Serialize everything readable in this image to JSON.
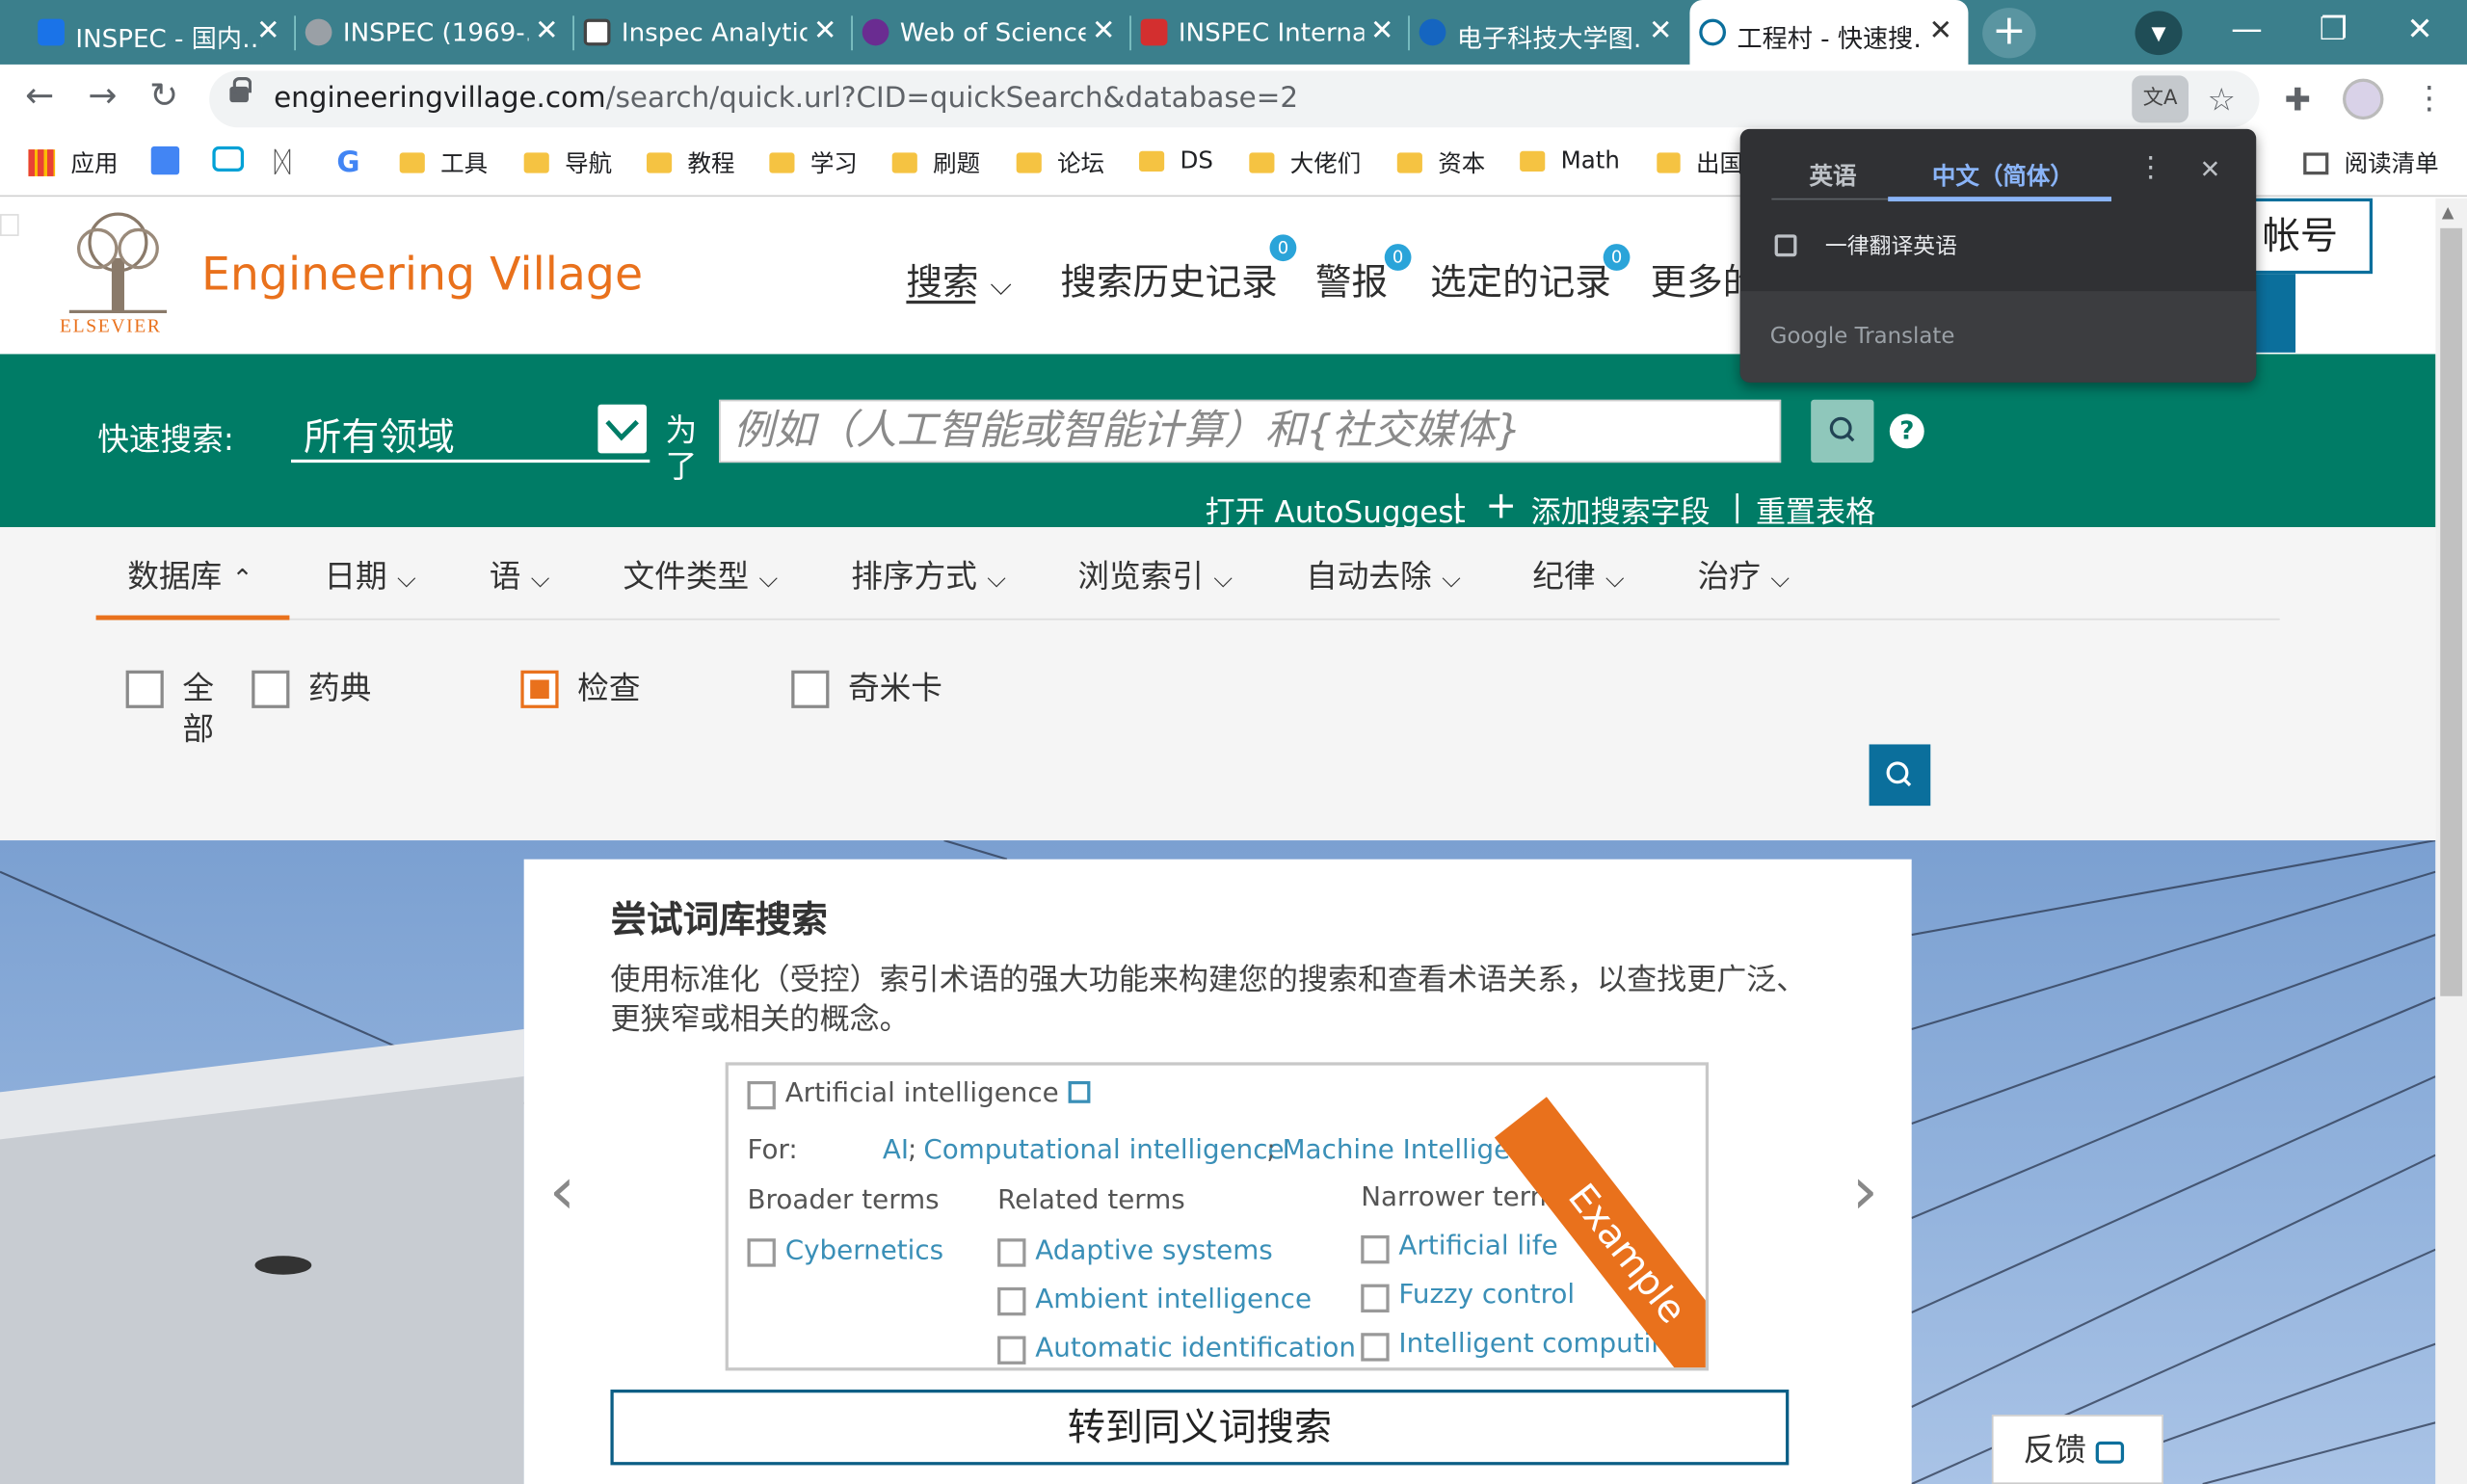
{
  "browser": {
    "tabs": [
      {
        "title": "INSPEC - 国内…",
        "fav_color": "#1a73e8"
      },
      {
        "title": "INSPEC (1969-…",
        "fav_color": "#9aa0a6"
      },
      {
        "title": "Inspec Analytic…",
        "fav_color": "#444444"
      },
      {
        "title": "Web of Science…",
        "fav_color": "#6a2c91"
      },
      {
        "title": "INSPEC Interna…",
        "fav_color": "#d32f2f"
      },
      {
        "title": "电子科技大学图…",
        "fav_color": "#1565c0"
      },
      {
        "title": "工程村 - 快速搜…",
        "fav_color": "#0b6f9c",
        "active": true
      }
    ],
    "url_domain": "engineeringvillage.com",
    "url_path": "/search/quick.url?CID=quickSearch&database=2",
    "bookmarks": [
      "应用",
      "工具",
      "导航",
      "教程",
      "学习",
      "刷题",
      "论坛",
      "DS",
      "大佬们",
      "资本",
      "Math",
      "出国"
    ],
    "reading_list": "阅读清单"
  },
  "site": {
    "brand": "Engineering Village",
    "publisher": "ELSEVIER",
    "nav": [
      {
        "label": "搜索",
        "badge": ""
      },
      {
        "label": "搜索历史记录",
        "badge": "0"
      },
      {
        "label": "警报",
        "badge": "0"
      },
      {
        "label": "选定的记录",
        "badge": "0"
      },
      {
        "label": "更多的",
        "badge": ""
      }
    ],
    "account_text": "帐号"
  },
  "search": {
    "label": "快速搜索:",
    "field_value": "所有领域",
    "for_label": "为了",
    "placeholder": "例如（人工智能或智能计算）和{社交媒体}",
    "autosuggest": "打开 AutoSuggest",
    "add_field": "添加搜索字段",
    "reset": "重置表格"
  },
  "filters": {
    "tabs": [
      "数据库",
      "日期",
      "语",
      "文件类型",
      "排序方式",
      "浏览索引",
      "自动去除",
      "纪律",
      "治疗"
    ],
    "databases": [
      {
        "label": "全部",
        "checked": false
      },
      {
        "label": "药典",
        "checked": false
      },
      {
        "label": "检查",
        "checked": true
      },
      {
        "label": "奇米卡",
        "checked": false
      }
    ]
  },
  "promo": {
    "title": "尝试词库搜索",
    "description": "使用标准化（受控）索引术语的强大功能来构建您的搜索和查看术语关系，以查找更广泛、更狭窄或相关的概念。",
    "example": {
      "term": "Artificial intelligence",
      "for_label": "For:",
      "for_links": [
        "AI",
        "Computational intelligence",
        "Machine Intelligence"
      ],
      "broader_header": "Broader terms",
      "related_header": "Related terms",
      "narrower_header": "Narrower terms",
      "broader": [
        "Cybernetics"
      ],
      "related": [
        "Adaptive systems",
        "Ambient intelligence",
        "Automatic identification"
      ],
      "narrower": [
        "Artificial life",
        "Fuzzy control",
        "Intelligent computing"
      ],
      "ribbon": "Example"
    },
    "cta": "转到同义词搜索",
    "feedback": "反馈"
  },
  "translate": {
    "lang_source": "英语",
    "lang_target": "中文（简体）",
    "always_translate": "一律翻译英语",
    "brand": "Google Translate"
  }
}
